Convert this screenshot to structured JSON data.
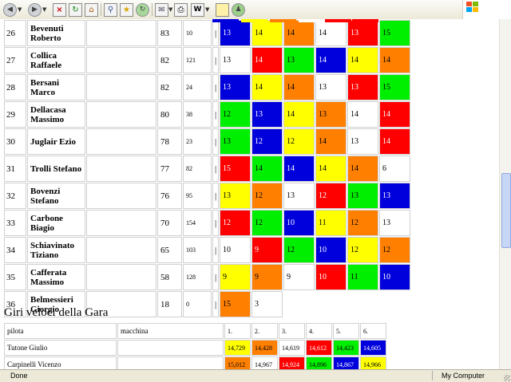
{
  "browser": {
    "toolbar_icons": [
      "back-icon",
      "forward-icon",
      "stop-icon",
      "refresh-icon",
      "home-icon",
      "search-icon",
      "favorites-icon",
      "history-icon",
      "mail-icon",
      "print-icon",
      "edit-icon",
      "discuss-icon",
      "messenger-icon"
    ],
    "edit_glyph": "W"
  },
  "colors": {
    "blue": "#0000dd",
    "yellow": "#ffff00",
    "orange": "#ff8000",
    "green": "#00ee00",
    "red": "#ff0000",
    "white": "#ffffff"
  },
  "top_clipped": [
    "blue",
    "yellow",
    "orange",
    "white",
    "red",
    "red"
  ],
  "standings": [
    {
      "pos": "26",
      "name": "Bevenuti Roberto",
      "laps": "83",
      "extra": "10",
      "bar": "|",
      "times": [
        [
          "13",
          "blue"
        ],
        [
          "14",
          "yellow"
        ],
        [
          "14",
          "orange"
        ],
        [
          "14",
          "white"
        ],
        [
          "13",
          "red"
        ],
        [
          "15",
          "green"
        ]
      ]
    },
    {
      "pos": "27",
      "name": "Collica Raffaele",
      "laps": "82",
      "extra": "121",
      "bar": "|",
      "times": [
        [
          "13",
          "white"
        ],
        [
          "14",
          "red"
        ],
        [
          "13",
          "green"
        ],
        [
          "14",
          "blue"
        ],
        [
          "14",
          "yellow"
        ],
        [
          "14",
          "orange"
        ]
      ]
    },
    {
      "pos": "28",
      "name": "Bersani Marco",
      "laps": "82",
      "extra": "24",
      "bar": "|",
      "times": [
        [
          "13",
          "blue"
        ],
        [
          "14",
          "yellow"
        ],
        [
          "14",
          "orange"
        ],
        [
          "13",
          "white"
        ],
        [
          "13",
          "red"
        ],
        [
          "15",
          "green"
        ]
      ]
    },
    {
      "pos": "29",
      "name": "Dellacasa Massimo",
      "laps": "80",
      "extra": "38",
      "bar": "|",
      "times": [
        [
          "12",
          "green"
        ],
        [
          "13",
          "blue"
        ],
        [
          "14",
          "yellow"
        ],
        [
          "13",
          "orange"
        ],
        [
          "14",
          "white"
        ],
        [
          "14",
          "red"
        ]
      ]
    },
    {
      "pos": "30",
      "name": "Juglair Ezio",
      "laps": "78",
      "extra": "23",
      "bar": "|",
      "times": [
        [
          "13",
          "green"
        ],
        [
          "12",
          "blue"
        ],
        [
          "12",
          "yellow"
        ],
        [
          "14",
          "orange"
        ],
        [
          "13",
          "white"
        ],
        [
          "14",
          "red"
        ]
      ]
    },
    {
      "pos": "31",
      "name": "Trolli Stefano",
      "laps": "77",
      "extra": "82",
      "bar": "|",
      "times": [
        [
          "15",
          "red"
        ],
        [
          "14",
          "green"
        ],
        [
          "14",
          "blue"
        ],
        [
          "14",
          "yellow"
        ],
        [
          "14",
          "orange"
        ],
        [
          "6",
          "white"
        ]
      ]
    },
    {
      "pos": "32",
      "name": "Bovenzi Stefano",
      "laps": "76",
      "extra": "95",
      "bar": "|",
      "times": [
        [
          "13",
          "yellow"
        ],
        [
          "12",
          "orange"
        ],
        [
          "13",
          "white"
        ],
        [
          "12",
          "red"
        ],
        [
          "13",
          "green"
        ],
        [
          "13",
          "blue"
        ]
      ]
    },
    {
      "pos": "33",
      "name": "Carbone Biagio",
      "laps": "70",
      "extra": "154",
      "bar": "|",
      "times": [
        [
          "12",
          "red"
        ],
        [
          "12",
          "green"
        ],
        [
          "10",
          "blue"
        ],
        [
          "11",
          "yellow"
        ],
        [
          "12",
          "orange"
        ],
        [
          "13",
          "white"
        ]
      ]
    },
    {
      "pos": "34",
      "name": "Schiavinato Tiziano",
      "laps": "65",
      "extra": "103",
      "bar": "|",
      "times": [
        [
          "10",
          "white"
        ],
        [
          "9",
          "red"
        ],
        [
          "12",
          "green"
        ],
        [
          "10",
          "blue"
        ],
        [
          "12",
          "yellow"
        ],
        [
          "12",
          "orange"
        ]
      ]
    },
    {
      "pos": "35",
      "name": "Cafferata Massimo",
      "laps": "58",
      "extra": "128",
      "bar": "|",
      "times": [
        [
          "9",
          "yellow"
        ],
        [
          "9",
          "orange"
        ],
        [
          "9",
          "white"
        ],
        [
          "10",
          "red"
        ],
        [
          "11",
          "green"
        ],
        [
          "10",
          "blue"
        ]
      ]
    },
    {
      "pos": "36",
      "name": "Belmessieri Giorgio",
      "laps": "18",
      "extra": "0",
      "bar": "|",
      "times": [
        [
          "15",
          "orange"
        ],
        [
          "3",
          "white"
        ]
      ]
    }
  ],
  "fast_laps": {
    "title": "Giri veloci della Gara",
    "headers": {
      "pilot": "pilota",
      "car": "macchina",
      "laps": [
        "1.",
        "2.",
        "3.",
        "4.",
        "5.",
        "6."
      ]
    },
    "rows": [
      {
        "pilot": "Tutone Giulio",
        "car": "",
        "laps": [
          [
            "14,729",
            "yellow"
          ],
          [
            "14,428",
            "orange"
          ],
          [
            "14,619",
            "white"
          ],
          [
            "14,612",
            "red"
          ],
          [
            "14,423",
            "green"
          ],
          [
            "14,605",
            "blue"
          ]
        ]
      },
      {
        "pilot": "Carpinelli Vicenzo",
        "car": "",
        "laps": [
          [
            "15,012",
            "orange"
          ],
          [
            "14,967",
            "white"
          ],
          [
            "14,924",
            "red"
          ],
          [
            "14,896",
            "green"
          ],
          [
            "14,867",
            "blue"
          ],
          [
            "14,966",
            "yellow"
          ]
        ]
      }
    ]
  },
  "status": {
    "left": "Done",
    "zone": "My Computer"
  }
}
